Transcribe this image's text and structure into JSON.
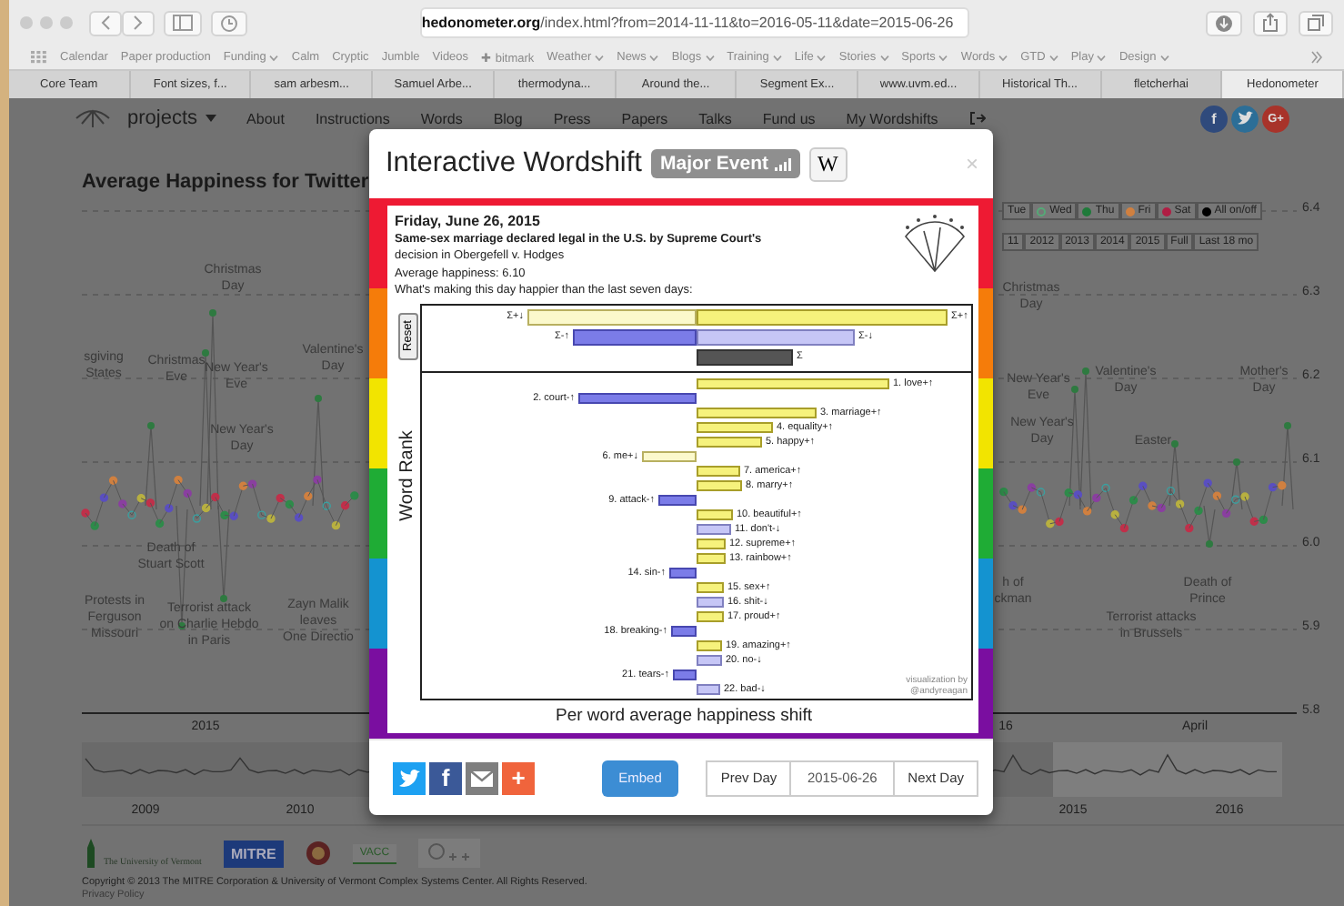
{
  "browser": {
    "url": "**hedonometer.org**/index.html?from=2014-11-11&to=2016-05-11&date=2015-06-26",
    "bookmarks": [
      {
        "label": "Calendar",
        "menu": false
      },
      {
        "label": "Paper production",
        "menu": false
      },
      {
        "label": "Funding",
        "menu": true
      },
      {
        "label": "Calm",
        "menu": false
      },
      {
        "label": "Cryptic",
        "menu": false
      },
      {
        "label": "Jumble",
        "menu": false
      },
      {
        "label": "Videos",
        "menu": false
      },
      {
        "label": "✚ bitmark",
        "menu": false
      },
      {
        "label": "Weather",
        "menu": true
      },
      {
        "label": "News",
        "menu": true
      },
      {
        "label": "Blogs",
        "menu": true
      },
      {
        "label": "Training",
        "menu": true
      },
      {
        "label": "Life",
        "menu": true
      },
      {
        "label": "Stories",
        "menu": true
      },
      {
        "label": "Sports",
        "menu": true
      },
      {
        "label": "Words",
        "menu": true
      },
      {
        "label": "GTD",
        "menu": true
      },
      {
        "label": "Play",
        "menu": true
      },
      {
        "label": "Design",
        "menu": true
      }
    ],
    "tabs": [
      {
        "label": "Core Team",
        "selected": false
      },
      {
        "label": "Font sizes, f...",
        "selected": false
      },
      {
        "label": "sam arbesm...",
        "selected": false
      },
      {
        "label": "Samuel Arbe...",
        "selected": false
      },
      {
        "label": "thermodyna...",
        "selected": false
      },
      {
        "label": "Around the...",
        "selected": false
      },
      {
        "label": "Segment Ex...",
        "selected": false
      },
      {
        "label": "www.uvm.ed...",
        "selected": false
      },
      {
        "label": "Historical Th...",
        "selected": false
      },
      {
        "label": "fletcherhai",
        "selected": false
      },
      {
        "label": "Hedonometer",
        "selected": true
      }
    ]
  },
  "nav": {
    "brand": "projects",
    "items": [
      "About",
      "Instructions",
      "Words",
      "Blog",
      "Press",
      "Papers",
      "Talks",
      "Fund us",
      "My Wordshifts"
    ],
    "social": [
      {
        "kind": "facebook",
        "glyph": "f"
      },
      {
        "kind": "twitter"
      },
      {
        "kind": "google",
        "glyph": "G+"
      }
    ]
  },
  "page_title": "Average Happiness for Twitter",
  "day_buttons": [
    {
      "label": "Tue"
    },
    {
      "label": "Wed",
      "color": "#55aa77",
      "hollow": true
    },
    {
      "label": "Thu",
      "color": "#1f7a3a",
      "hollow": false
    },
    {
      "label": "Fri",
      "color": "#d08040",
      "hollow": false
    },
    {
      "label": "Sat",
      "color": "#b01e44",
      "hollow": false
    },
    {
      "label": "All on/off",
      "color": "#000000",
      "hollow": false
    }
  ],
  "range_buttons": [
    "11",
    "2012",
    "2013",
    "2014",
    "2015",
    "Full",
    "Last 18 mo"
  ],
  "y_ticks": [
    "6.4",
    "6.3",
    "6.2",
    "6.1",
    "6.0",
    "5.9",
    "5.8"
  ],
  "x_ticks": [
    "2015",
    "16",
    "April"
  ],
  "annotations": [
    {
      "lines": [
        "Christmas",
        "Day"
      ]
    },
    {
      "lines": [
        "sgiving",
        "States"
      ]
    },
    {
      "lines": [
        "Christmas",
        "Eve"
      ]
    },
    {
      "lines": [
        "New Year's",
        "Eve"
      ]
    },
    {
      "lines": [
        "New Year's",
        "Day"
      ]
    },
    {
      "lines": [
        "Valentine's",
        "Day"
      ]
    },
    {
      "lines": [
        "Death of",
        "Stuart Scott"
      ]
    },
    {
      "lines": [
        "Protests in",
        "Ferguson",
        "Missouri"
      ]
    },
    {
      "lines": [
        "Terrorist attack",
        "on Charlie Hebdo",
        "in Paris"
      ]
    },
    {
      "lines": [
        "Zayn Malik",
        "leaves",
        "One Directio"
      ]
    },
    {
      "lines": [
        "Christmas",
        "Day"
      ]
    },
    {
      "lines": [
        "New Year's",
        "Eve"
      ]
    },
    {
      "lines": [
        "New Year's",
        "Day"
      ]
    },
    {
      "lines": [
        "Valentine's",
        "Day"
      ]
    },
    {
      "lines": [
        "Easter"
      ]
    },
    {
      "lines": [
        "Mother's",
        "Day"
      ]
    },
    {
      "lines": [
        "h of",
        "ckman"
      ]
    },
    {
      "lines": [
        "Death of",
        "Prince"
      ]
    },
    {
      "lines": [
        "Terrorist attacks",
        "in Brussels"
      ]
    }
  ],
  "mini_ticks": [
    "2009",
    "2010",
    "2015",
    "2016"
  ],
  "footer": {
    "logos": [
      {
        "kind": "uvm",
        "text": "The University of Vermont"
      },
      {
        "kind": "mitre",
        "text": "MITRE"
      },
      {
        "kind": "seal"
      },
      {
        "kind": "vacc",
        "text": "VACC"
      },
      {
        "kind": "complex"
      }
    ],
    "copyright": "Copyright © 2013 The MITRE Corporation & University of Vermont Complex Systems Center. All Rights Reserved.",
    "privacy": "Privacy Policy"
  },
  "modal": {
    "title": "Interactive Wordshift",
    "badge": "Major Event",
    "wiki": "W",
    "close": "×",
    "date": "Friday, June 26, 2015",
    "event": "Same-sex marriage declared legal in the U.S. by Supreme Court's",
    "event_cont": "decision in Obergefell v. Hodges",
    "average": "Average happiness: 6.10",
    "question": "What's making this day happier than the last seven days:",
    "reset": "Reset",
    "y_label": "Word Rank",
    "x_label": "Per word average happiness shift",
    "credit": [
      "visualization by",
      "@andyreagan"
    ],
    "summary_rows": [
      [
        {
          "label": "Σ+↓",
          "kind": "pos_down"
        },
        {
          "label": "Σ+↑",
          "kind": "pos_up"
        }
      ],
      [
        {
          "label": "Σ-↑",
          "kind": "neg_up"
        },
        {
          "label": "Σ-↓",
          "kind": "neg_down"
        }
      ],
      [
        {
          "label": "Σ",
          "kind": "total"
        }
      ]
    ],
    "words": [
      {
        "label": "1. love+↑",
        "kind": "pos_up"
      },
      {
        "label": "2. court-↑",
        "kind": "neg_up"
      },
      {
        "label": "3. marriage+↑",
        "kind": "pos_up"
      },
      {
        "label": "4. equality+↑",
        "kind": "pos_up"
      },
      {
        "label": "5. happy+↑",
        "kind": "pos_up"
      },
      {
        "label": "6. me+↓",
        "kind": "pos_down"
      },
      {
        "label": "7. america+↑",
        "kind": "pos_up"
      },
      {
        "label": "8. marry+↑",
        "kind": "pos_up"
      },
      {
        "label": "9. attack-↑",
        "kind": "neg_up"
      },
      {
        "label": "10. beautiful+↑",
        "kind": "pos_up"
      },
      {
        "label": "11. don't-↓",
        "kind": "neg_down"
      },
      {
        "label": "12. supreme+↑",
        "kind": "pos_up"
      },
      {
        "label": "13. rainbow+↑",
        "kind": "pos_up"
      },
      {
        "label": "14. sin-↑",
        "kind": "neg_up"
      },
      {
        "label": "15. sex+↑",
        "kind": "pos_up"
      },
      {
        "label": "16. shit-↓",
        "kind": "neg_down"
      },
      {
        "label": "17. proud+↑",
        "kind": "pos_up"
      },
      {
        "label": "18. breaking-↑",
        "kind": "neg_up"
      },
      {
        "label": "19. amazing+↑",
        "kind": "pos_up"
      },
      {
        "label": "20. no-↓",
        "kind": "neg_down"
      },
      {
        "label": "21. tears-↑",
        "kind": "neg_up"
      },
      {
        "label": "22. bad-↓",
        "kind": "neg_down"
      }
    ],
    "share": [
      {
        "kind": "twitter"
      },
      {
        "kind": "facebook",
        "glyph": "f"
      },
      {
        "kind": "mail"
      },
      {
        "kind": "plus",
        "glyph": "+"
      }
    ],
    "embed": "Embed",
    "prev": "Prev Day",
    "date_value": "2015-06-26",
    "next": "Next Day"
  }
}
